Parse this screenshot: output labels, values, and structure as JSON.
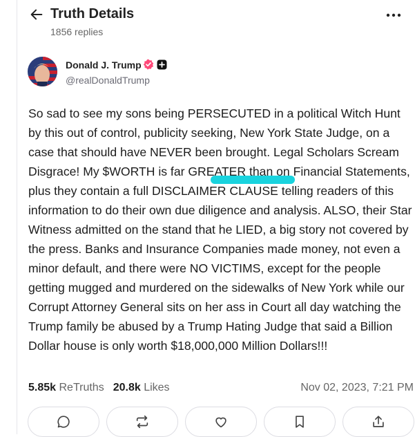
{
  "header": {
    "title": "Truth Details",
    "replies": "1856 replies",
    "back_icon": "arrow-left-icon",
    "more_icon": "more-horizontal-icon"
  },
  "author": {
    "name": "Donald J. Trump",
    "handle": "@realDonaldTrump",
    "verified_color": "#ff4a7a"
  },
  "post": {
    "text": "So sad to see my sons being PERSECUTED in a political Witch Hunt by this out of control, publicity seeking, New York State Judge, on a case that should have NEVER been brought. Legal Scholars Scream Disgrace! My $WORTH is far GREATER than on Financial Statements, plus they contain a full DISCLAIMER CLAUSE telling readers of this information to do their own due diligence and analysis. ALSO, their Star Witness admitted on the stand that he LIED, a big story not covered by the press. Banks and Insurance Companies made money, not even a minor default, and there were NO VICTIMS, except for the people getting mugged and murdered on the sidewalks of New York while our Corrupt Attorney General sits on her ass in Court all day watching the Trump family be abused by a Trump Hating Judge that said a Billion Dollar house is only worth $18,000,000 Million Dollars!!!",
    "highlight_color": "#19d3de"
  },
  "stats": {
    "retruths_count": "5.85k",
    "retruths_label": "ReTruths",
    "likes_count": "20.8k",
    "likes_label": "Likes",
    "date": "Nov 02, 2023, 7:21 PM"
  },
  "actions": {
    "reply_icon": "reply-icon",
    "retruth_icon": "retruth-icon",
    "like_icon": "heart-icon",
    "bookmark_icon": "bookmark-icon",
    "share_icon": "share-icon"
  }
}
